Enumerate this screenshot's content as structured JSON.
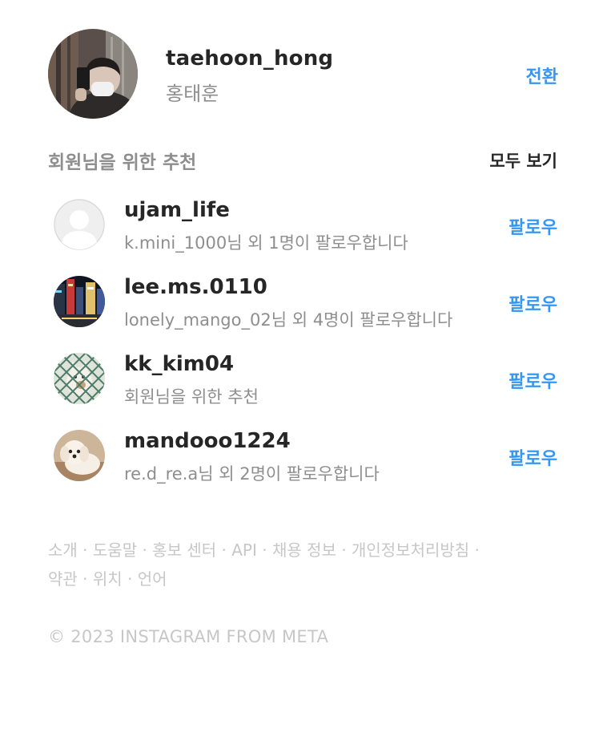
{
  "current_account": {
    "username": "taehoon_hong",
    "full_name": "홍태훈",
    "switch_label": "전환",
    "avatar_icon": "profile-photo"
  },
  "suggestions": {
    "title": "회원님을 위한 추천",
    "see_all_label": "모두 보기",
    "items": [
      {
        "username": "ujam_life",
        "subtitle": "k.mini_1000님 외 1명이 팔로우합니다",
        "follow_label": "팔로우",
        "avatar_icon": "default-avatar-icon"
      },
      {
        "username": "lee.ms.0110",
        "subtitle": "lonely_mango_02님 외 4명이 팔로우합니다",
        "follow_label": "팔로우",
        "avatar_icon": "city-night-photo"
      },
      {
        "username": "kk_kim04",
        "subtitle": "회원님을 위한 추천",
        "follow_label": "팔로우",
        "avatar_icon": "cat-behind-fence-photo"
      },
      {
        "username": "mandooo1224",
        "subtitle": "re.d_re.a님 외 2명이 팔로우합니다",
        "follow_label": "팔로우",
        "avatar_icon": "white-puppy-photo"
      }
    ]
  },
  "footer": {
    "links": [
      "소개",
      "도움말",
      "홍보 센터",
      "API",
      "채용 정보",
      "개인정보처리방침",
      "약관",
      "위치",
      "언어"
    ],
    "separator": "·",
    "copyright": "© 2023 INSTAGRAM FROM META"
  },
  "colors": {
    "accent": "#3797ef",
    "text_primary": "#262626",
    "text_secondary": "#8e8e8e",
    "text_muted": "#c7c7c7"
  }
}
